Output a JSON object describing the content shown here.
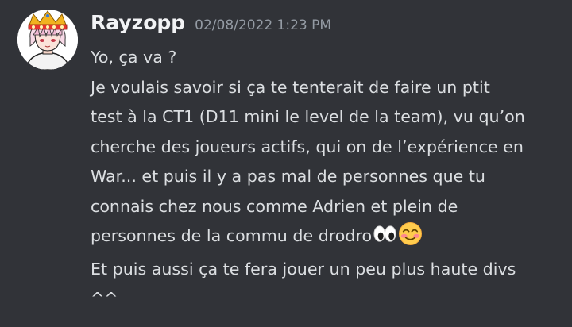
{
  "message": {
    "author": "Rayzopp",
    "timestamp": "02/08/2022 1:23 PM",
    "avatar_icon": "avatar-crowned-anime-boy",
    "lines": [
      "Yo, ça va ?\nJe voulais savoir si ça te tenterait de faire un ptit\ntest à la CT1 (D11 mini le level de la team), vu qu’on\ncherche des joueurs actifs, qui on de l’expérience en\nWar... et puis il y a pas mal de personnes que tu\nconnais chez nous comme Adrien et plein de\npersonnes de la commu de drodro",
      "Et puis aussi ça te fera jouer un peu plus haute divs\n^^"
    ],
    "emojis": [
      "eyes-emoji",
      "smiling-face-with-smiling-eyes-emoji"
    ]
  },
  "colors": {
    "background": "#313338",
    "username": "#f2f3f5",
    "timestamp": "#949ba4",
    "text": "#dbdee1"
  }
}
